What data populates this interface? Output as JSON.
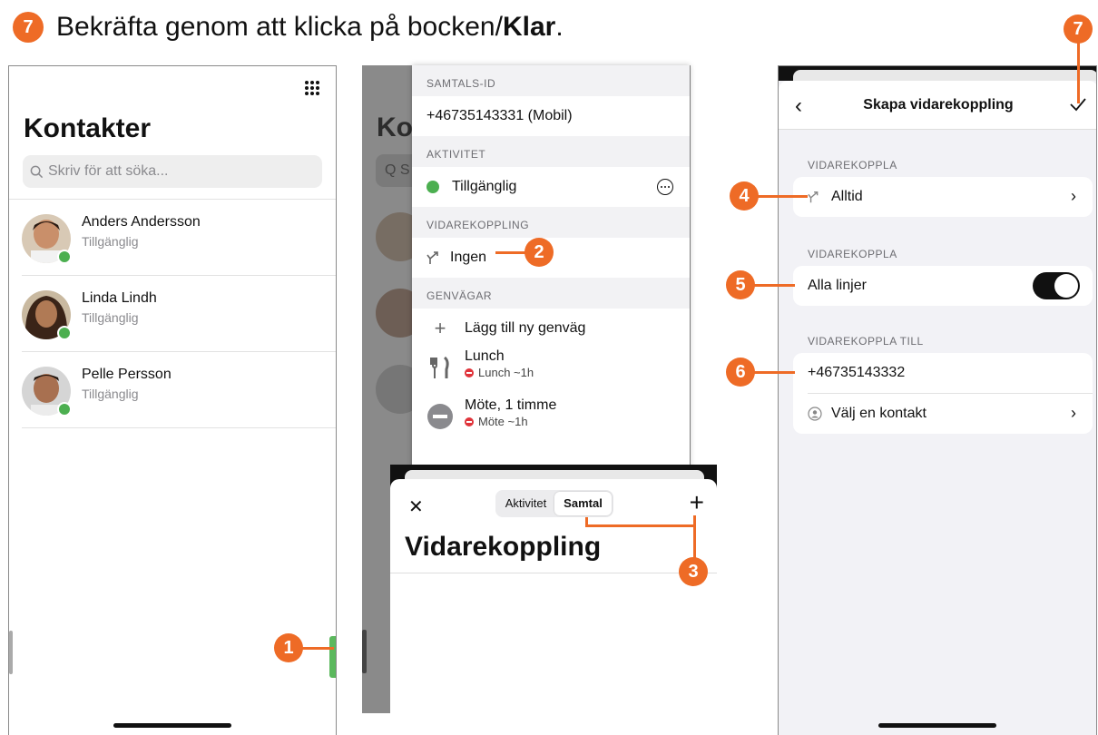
{
  "headline": {
    "step": "7",
    "text": "Bekräfta genom att klicka på bocken/",
    "emphasis": "Klar",
    "tail": "."
  },
  "callouts": {
    "one": "1",
    "two": "2",
    "three": "3",
    "four": "4",
    "five": "5",
    "six": "6",
    "seven": "7"
  },
  "contacts_screen": {
    "title": "Kontakter",
    "search_placeholder": "Skriv för att söka...",
    "contacts": [
      {
        "name": "Anders Andersson",
        "status": "Tillgänglig"
      },
      {
        "name": "Linda Lindh",
        "status": "Tillgänglig"
      },
      {
        "name": "Pelle Persson",
        "status": "Tillgänglig"
      }
    ]
  },
  "dimmed": {
    "title": "Ko",
    "search_letter": "Q S"
  },
  "menu": {
    "id_header": "SAMTALS-ID",
    "id_value": "+46735143331 (Mobil)",
    "activity_header": "AKTIVITET",
    "activity_value": "Tillgänglig",
    "forward_header": "VIDAREKOPPLING",
    "forward_value": "Ingen",
    "shortcuts_header": "GENVÄGAR",
    "add_shortcut": "Lägg till ny genväg",
    "shortcuts": [
      {
        "title": "Lunch",
        "sub": "Lunch ~1h"
      },
      {
        "title": "Möte, 1 timme",
        "sub": "Möte ~1h"
      }
    ]
  },
  "sheet": {
    "close": "✕",
    "tabs": [
      "Aktivitet",
      "Samtal"
    ],
    "plus": "+",
    "title": "Vidarekoppling"
  },
  "create_screen": {
    "title": "Skapa vidarekoppling",
    "section1": "VIDAREKOPPLA",
    "always": "Alltid",
    "section2": "VIDAREKOPPLA",
    "all_lines": "Alla linjer",
    "all_lines_on": true,
    "section3": "VIDAREKOPPLA TILL",
    "number": "+46735143332",
    "choose_contact": "Välj en kontakt"
  },
  "colors": {
    "accent": "#ee6b26",
    "available": "#4caf50",
    "busy": "#e0333a"
  }
}
